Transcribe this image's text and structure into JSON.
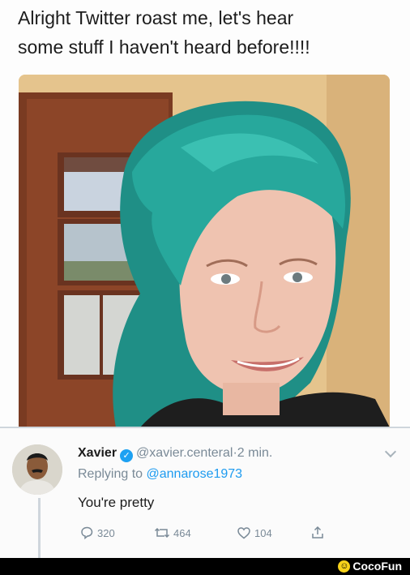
{
  "post": {
    "text": "Alright Twitter roast me, let's hear\nsome stuff I haven't heard before!!!!"
  },
  "reply": {
    "name": "Xavier",
    "handle": "@xavier.centeral",
    "separator": "·",
    "time": "2 min.",
    "replying_prefix": "Replying to",
    "replying_to": "@annarose1973",
    "text": "You're pretty",
    "actions": {
      "replies": "320",
      "retweets": "464",
      "likes": "104"
    }
  },
  "watermark": {
    "brand": "CocoFun"
  },
  "colors": {
    "link": "#1d9bf0",
    "muted": "#7a8a97",
    "verified": "#1da1f2",
    "hair": "#2aa39a"
  },
  "icons": [
    "verified-badge-icon",
    "chevron-down-icon",
    "reply-icon",
    "retweet-icon",
    "like-icon",
    "share-icon",
    "smiley-logo-icon"
  ]
}
